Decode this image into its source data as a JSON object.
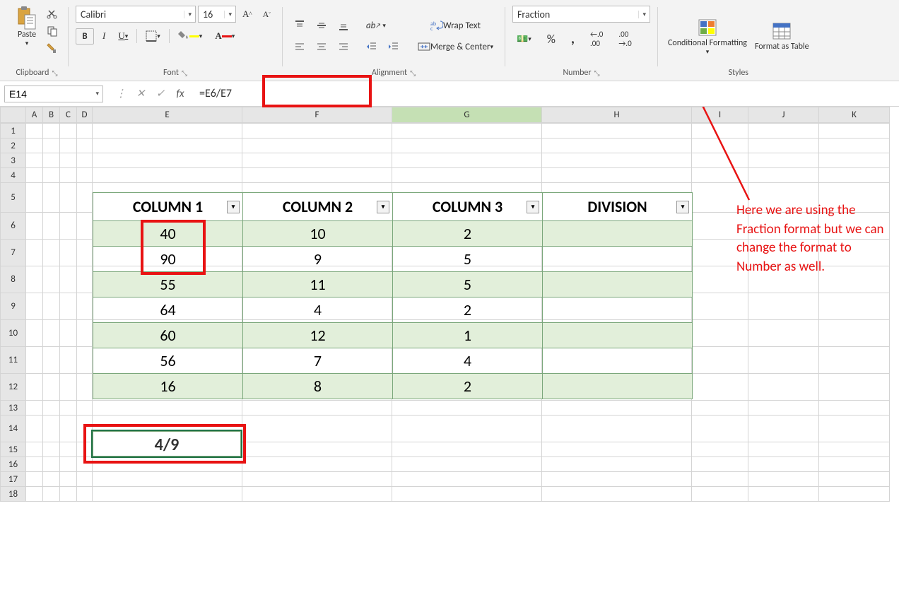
{
  "ribbon": {
    "clipboard": {
      "paste": "Paste",
      "group_label": "Clipboard"
    },
    "font": {
      "name": "Calibri",
      "size": "16",
      "group_label": "Font",
      "bold": "B",
      "italic": "I",
      "underline": "U"
    },
    "alignment": {
      "wrap_text": "Wrap Text",
      "merge_center": "Merge & Center",
      "group_label": "Alignment"
    },
    "number": {
      "format": "Fraction",
      "group_label": "Number"
    },
    "styles": {
      "cond_format": "Conditional Formatting",
      "format_table": "Format as Table",
      "group_label": "Styles"
    }
  },
  "formula_bar": {
    "cell_ref": "E14",
    "fx": "fx",
    "formula": "=E6/E7"
  },
  "columns": [
    "A",
    "B",
    "C",
    "D",
    "E",
    "F",
    "G",
    "H",
    "I",
    "J",
    "K"
  ],
  "table": {
    "headers": [
      "COLUMN 1",
      "COLUMN 2",
      "COLUMN 3",
      "DIVISION"
    ],
    "rows": [
      [
        "40",
        "10",
        "2",
        ""
      ],
      [
        "90",
        "9",
        "5",
        ""
      ],
      [
        "55",
        "11",
        "5",
        ""
      ],
      [
        "64",
        "4",
        "2",
        ""
      ],
      [
        "60",
        "12",
        "1",
        ""
      ],
      [
        "56",
        "7",
        "4",
        ""
      ],
      [
        "16",
        "8",
        "2",
        ""
      ]
    ]
  },
  "result": "4/9",
  "annotation_text": "Here we are using the Fraction format but we can change the format to Number as well."
}
